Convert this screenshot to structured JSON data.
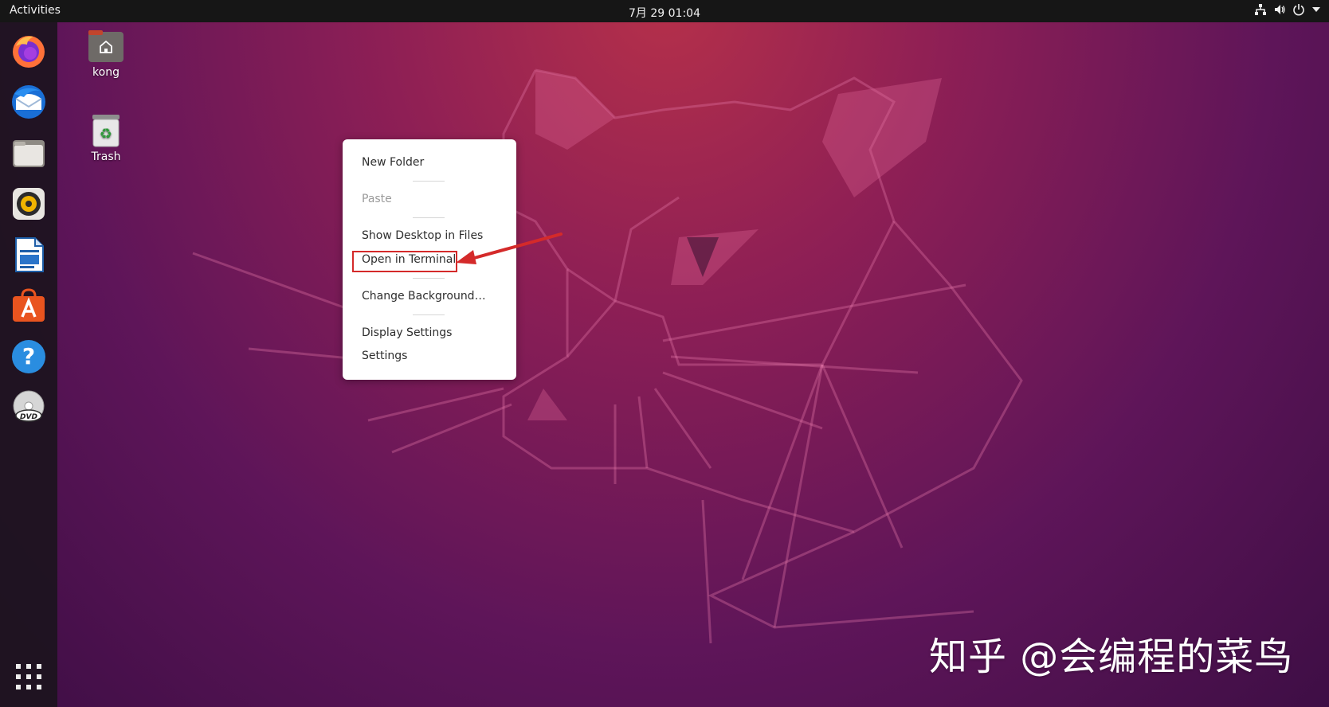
{
  "topbar": {
    "activities": "Activities",
    "clock": "7月 29  01:04",
    "tray_icons": [
      "network-icon",
      "volume-icon",
      "power-icon",
      "chevron-down-icon"
    ]
  },
  "dock": {
    "items": [
      "firefox",
      "thunderbird",
      "files",
      "rhythmbox",
      "libreoffice-writer",
      "ubuntu-software",
      "help",
      "dvd",
      "show-applications"
    ]
  },
  "desktop": {
    "icons": [
      {
        "label": "kong",
        "icon": "home-folder-icon"
      },
      {
        "label": "Trash",
        "icon": "trash-icon"
      }
    ]
  },
  "context_menu": {
    "items": [
      {
        "label": "New Folder",
        "enabled": true
      },
      {
        "label": "Paste",
        "enabled": false
      },
      {
        "label": "Show Desktop in Files",
        "enabled": true
      },
      {
        "label": "Open in Terminal",
        "enabled": true,
        "annotated": true
      },
      {
        "label": "Change Background…",
        "enabled": true
      },
      {
        "label": "Display Settings",
        "enabled": true
      },
      {
        "label": "Settings",
        "enabled": true
      }
    ]
  },
  "watermark": "知乎 @会编程的菜鸟",
  "colors": {
    "annotation": "#d42a2a",
    "topbar": "#161616",
    "wallpaper_top": "#b5304a",
    "wallpaper_bottom": "#3e0e45"
  }
}
